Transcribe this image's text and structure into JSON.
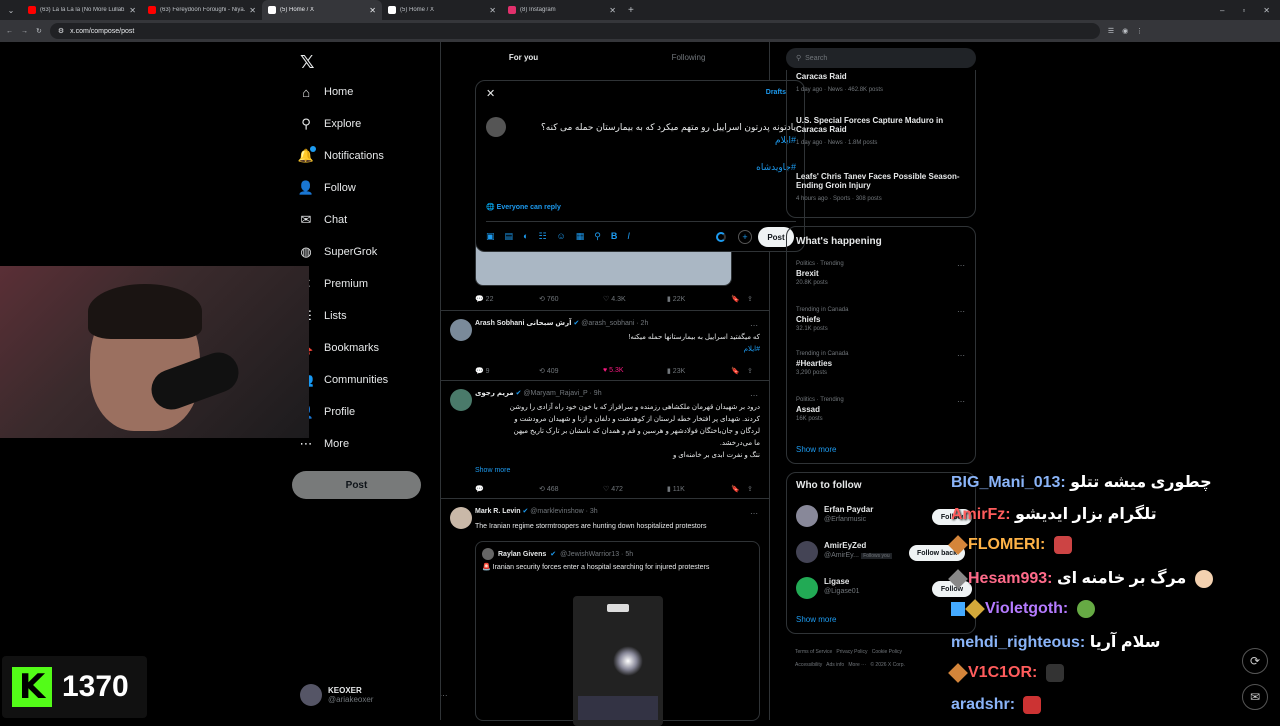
{
  "browser": {
    "tabs": [
      {
        "title": "(63) La la La la (No More Lullab...",
        "color": "#ff0000",
        "active": false
      },
      {
        "title": "(63) Fereydoon Foroughi - Niya...",
        "color": "#ff0000",
        "active": false
      },
      {
        "title": "(5) Home / X",
        "color": "#ffffff",
        "active": true
      },
      {
        "title": "(5) Home / X",
        "color": "#ffffff",
        "active": false
      },
      {
        "title": "(8) Instagram",
        "color": "#e1306c",
        "active": false
      }
    ],
    "url": "x.com/compose/post"
  },
  "nav": {
    "logo": "𝕏",
    "items": [
      {
        "label": "Home",
        "icon": "⌂"
      },
      {
        "label": "Explore",
        "icon": "⚲"
      },
      {
        "label": "Notifications",
        "icon": "🔔"
      },
      {
        "label": "Follow",
        "icon": "👤"
      },
      {
        "label": "Chat",
        "icon": "✉"
      },
      {
        "label": "SuperGrok",
        "icon": "◍"
      },
      {
        "label": "Premium",
        "icon": "✕"
      },
      {
        "label": "Lists",
        "icon": "☰"
      },
      {
        "label": "Bookmarks",
        "icon": "🔖"
      },
      {
        "label": "Communities",
        "icon": "👥"
      },
      {
        "label": "Profile",
        "icon": "👤"
      },
      {
        "label": "More",
        "icon": "⋯"
      }
    ],
    "post_label": "Post",
    "account": {
      "name": "KEOXER",
      "handle": "@ariakeoxer"
    }
  },
  "feed": {
    "tabs": [
      "For you",
      "Following"
    ],
    "top_actions": [
      "22",
      "760",
      "4.3K",
      "22K"
    ],
    "tweets": [
      {
        "name": "Arash Sobhani آرش سبحانی",
        "handle": "@arash_sobhani · 2h",
        "lines": [
          "که میگفتید اسراییل به بیمارستانها حمله میکنه!"
        ],
        "tags": [
          "#ایلام"
        ],
        "actions": [
          "9",
          "409",
          "5.3K",
          "23K"
        ]
      },
      {
        "name": "مریم رجوی",
        "handle": "@Maryam_Rajavi_P · 9h",
        "lines": [
          "درود بر شهیدان قهرمان ملکشاهی رزمنده و سرافراز که با خون خود راه آزادی را روشن",
          "کردند. شهدای پر افتخار خطه لرستان از کوهدشت و دلفان و ازنا و شهیدان مرودشت و",
          "لردگان و جان‌باختگان فولادشهر و هرسین و قم و همدان که نامشان بر تارک تاریخ میهن",
          "ما می‌درخشد.",
          "ننگ و نفرت ابدی بر خامنه‌ای و"
        ],
        "show_more": "Show more",
        "actions": [
          "",
          "468",
          "472",
          "11K"
        ]
      },
      {
        "name": "Mark R. Levin",
        "handle": "@marklevinshow · 3h",
        "lines": [
          "The Iranian regime stormtroopers are hunting down hospitalized protestors"
        ],
        "quote": {
          "name": "Raylan Givens",
          "handle": "@JewishWarrior13 · 5h",
          "text": "🚨 Iranian security forces enter a hospital searching for injured protesters"
        }
      }
    ]
  },
  "compose": {
    "close": "✕",
    "drafts": "Drafts",
    "text": "یادتونه پدرتون اسراییل رو متهم میکرد که به بیمارستان حمله می کنه؟",
    "tag1": "#ایلام",
    "tag2": "#جاویدشاه",
    "reply": "Everyone can reply",
    "tools": [
      "▣",
      "▤",
      "◐",
      "☷",
      "☺",
      "▦",
      "⚲",
      "B",
      "I"
    ],
    "post": "Post"
  },
  "right": {
    "search_placeholder": "Search",
    "news": [
      {
        "title": "Caracas Raid",
        "meta": "1 day ago · News · 462.8K posts"
      },
      {
        "title": "U.S. Special Forces Capture Maduro in Caracas Raid",
        "meta": "1 day ago · News · 1.8M posts"
      },
      {
        "title": "Leafs' Chris Tanev Faces Possible Season-Ending Groin Injury",
        "meta": "4 hours ago · Sports · 308 posts"
      }
    ],
    "happening_title": "What's happening",
    "trends": [
      {
        "cat": "Politics · Trending",
        "name": "Brexit",
        "count": "20.8K posts"
      },
      {
        "cat": "Trending in Canada",
        "name": "Chiefs",
        "count": "32.1K posts"
      },
      {
        "cat": "Trending in Canada",
        "name": "#Hearties",
        "count": "3,290 posts"
      },
      {
        "cat": "Politics · Trending",
        "name": "Assad",
        "count": "16K posts"
      }
    ],
    "show_more": "Show more",
    "wtf_title": "Who to follow",
    "follow": [
      {
        "name": "Erfan Paydar",
        "handle": "@Erfanmusic",
        "btn": "Follow"
      },
      {
        "name": "AmirEyZed",
        "handle": "@AmirEy...",
        "follows_you": "Follows you",
        "btn": "Follow back"
      },
      {
        "name": "Ligase",
        "handle": "@Ligase01",
        "btn": "Follow"
      }
    ],
    "footer": [
      "Terms of Service",
      "Privacy Policy",
      "Cookie Policy",
      "Accessibility",
      "Ads info",
      "More ···",
      "© 2026 X Corp."
    ]
  },
  "overlay": {
    "viewer_count": "1370",
    "kick_logo": "K",
    "chat": [
      {
        "user": "BIG_Mani_013",
        "msg": "چطوری میشه تتلو",
        "color": "#8ab4f8"
      },
      {
        "user": "AmirFz",
        "msg": "تلگرام بزار ایدیشو",
        "color": "#ff5c5c"
      },
      {
        "user": "FLOMERI",
        "msg": "",
        "color": "#ffb347"
      },
      {
        "user": "Hesam993",
        "msg": "مرگ بر خامنه ای",
        "color": "#ff6b8a"
      },
      {
        "user": "Violetgoth",
        "msg": "",
        "color": "#b57bff"
      },
      {
        "user": "mehdi_righteous",
        "msg": "سلام آریا",
        "color": "#8ab4f8"
      },
      {
        "user": "V1C1OR",
        "msg": "",
        "color": "#ff5c5c"
      },
      {
        "user": "aradshr",
        "msg": "",
        "color": "#8ab4f8"
      }
    ]
  }
}
